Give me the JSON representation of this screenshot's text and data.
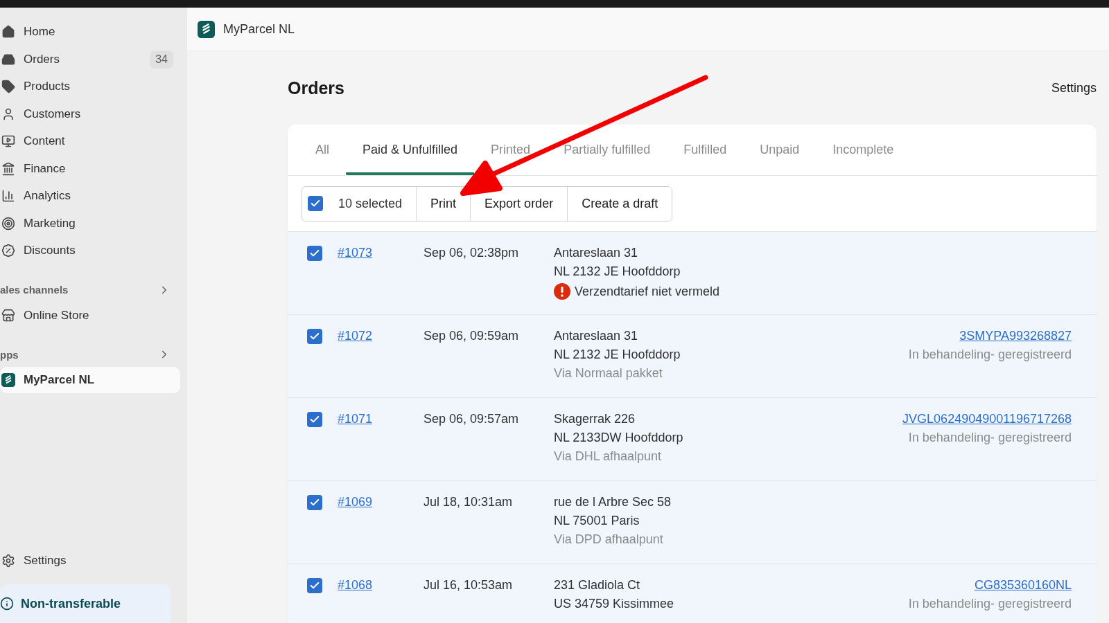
{
  "sidebar": {
    "items": [
      {
        "label": "Home",
        "selected": false
      },
      {
        "label": "Orders",
        "badge": "34",
        "selected": false
      },
      {
        "label": "Products",
        "selected": false
      },
      {
        "label": "Customers",
        "selected": false
      },
      {
        "label": "Content",
        "selected": false
      },
      {
        "label": "Finance",
        "selected": false
      },
      {
        "label": "Analytics",
        "selected": false
      },
      {
        "label": "Marketing",
        "selected": false
      },
      {
        "label": "Discounts",
        "selected": false
      }
    ],
    "sections": [
      {
        "title": "ales channels",
        "items": [
          {
            "label": "Online Store",
            "selected": false
          }
        ]
      },
      {
        "title": "pps",
        "items": [
          {
            "label": "MyParcel NL",
            "selected": true
          }
        ]
      }
    ],
    "footer_items": [
      {
        "label": "Settings",
        "selected": false
      }
    ],
    "banner": "Non-transferable"
  },
  "header": {
    "app_title": "MyParcel NL"
  },
  "page": {
    "title": "Orders",
    "action": "Settings"
  },
  "tabs": [
    {
      "label": "All",
      "selected": false
    },
    {
      "label": "Paid & Unfulfilled",
      "selected": true
    },
    {
      "label": "Printed",
      "selected": false
    },
    {
      "label": "Partially fulfilled",
      "selected": false
    },
    {
      "label": "Fulfilled",
      "selected": false
    },
    {
      "label": "Unpaid",
      "selected": false
    },
    {
      "label": "Incomplete",
      "selected": false
    }
  ],
  "bulk": {
    "checked": true,
    "count_label": "10 selected",
    "actions": [
      "Print",
      "Export order",
      "Create a draft"
    ]
  },
  "orders": [
    {
      "checked": true,
      "number": "#1073",
      "date": "Sep 06, 02:38pm",
      "lines": [
        {
          "kind": "address",
          "text": "Antareslaan 31"
        },
        {
          "kind": "address",
          "text": "NL 2132 JE Hoofddorp"
        },
        {
          "kind": "warning",
          "text": "Verzendtarief niet vermeld"
        }
      ]
    },
    {
      "checked": true,
      "number": "#1072",
      "date": "Sep 06, 09:59am",
      "lines": [
        {
          "kind": "address",
          "text": "Antareslaan 31"
        },
        {
          "kind": "address",
          "text": "NL 2132 JE Hoofddorp"
        },
        {
          "kind": "via",
          "text": "Via Normaal pakket"
        }
      ],
      "tracking": {
        "code": "3SMYPA993268827",
        "status": "In behandeling- geregistreerd"
      }
    },
    {
      "checked": true,
      "number": "#1071",
      "date": "Sep 06, 09:57am",
      "lines": [
        {
          "kind": "address",
          "text": "Skagerrak 226"
        },
        {
          "kind": "address",
          "text": "NL 2133DW Hoofddorp"
        },
        {
          "kind": "via",
          "text": "Via DHL afhaalpunt"
        }
      ],
      "tracking": {
        "code": "JVGL06249049001196717268",
        "status": "In behandeling- geregistreerd"
      }
    },
    {
      "checked": true,
      "number": "#1069",
      "date": "Jul 18, 10:31am",
      "lines": [
        {
          "kind": "address",
          "text": "rue de l Arbre Sec 58"
        },
        {
          "kind": "address",
          "text": "NL 75001 Paris"
        },
        {
          "kind": "via",
          "text": "Via DPD afhaalpunt"
        }
      ]
    },
    {
      "checked": true,
      "number": "#1068",
      "date": "Jul 16, 10:53am",
      "lines": [
        {
          "kind": "address",
          "text": "231 Gladiola Ct"
        },
        {
          "kind": "address",
          "text": "US 34759 Kissimmee"
        }
      ],
      "tracking": {
        "code": "CG835360160NL",
        "status": "In behandeling- geregistreerd"
      }
    }
  ]
}
